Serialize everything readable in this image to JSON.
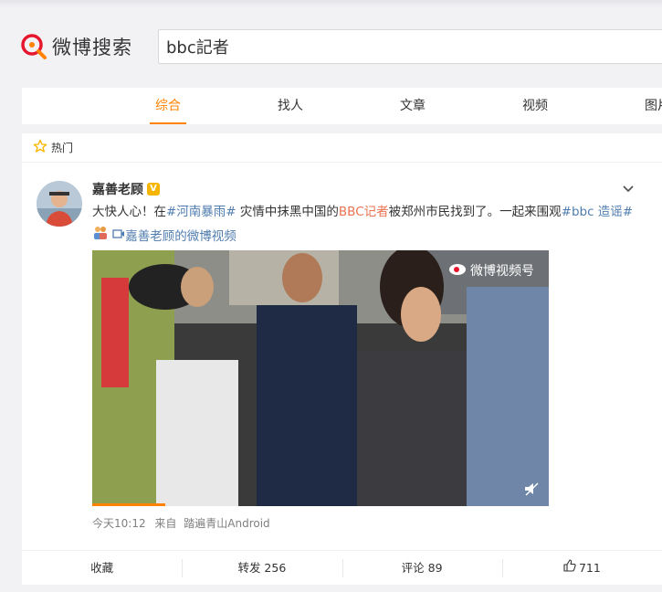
{
  "brand": {
    "name": "微博搜索",
    "accent": "#ff8200",
    "logo_color": "#e6162d"
  },
  "search": {
    "query": "bbc記者"
  },
  "tabs": [
    {
      "label": "综合",
      "active": true
    },
    {
      "label": "找人"
    },
    {
      "label": "文章"
    },
    {
      "label": "视频"
    },
    {
      "label": "图片"
    }
  ],
  "hot_section": {
    "label": "热门"
  },
  "post": {
    "author": "嘉善老顾",
    "verified_badge": "V",
    "text_1": "大快人心！在",
    "topic_1": "#河南暴雨#",
    "text_2": " 灾情中抹黑中国的",
    "link_1": "BBC记者",
    "text_3": "被郑州市民找到了。一起来围观",
    "topic_2": "#bbc 造谣#",
    "video_link": "嘉善老顾的微博视频",
    "video_watermark": "微博视频号",
    "time": "今天10:12",
    "source_prefix": "来自",
    "source": "踏遍青山Android",
    "video_progress": 0.16
  },
  "actions": {
    "collect": "收藏",
    "repost": "转发 256",
    "comment": "评论 89",
    "like": "711"
  }
}
